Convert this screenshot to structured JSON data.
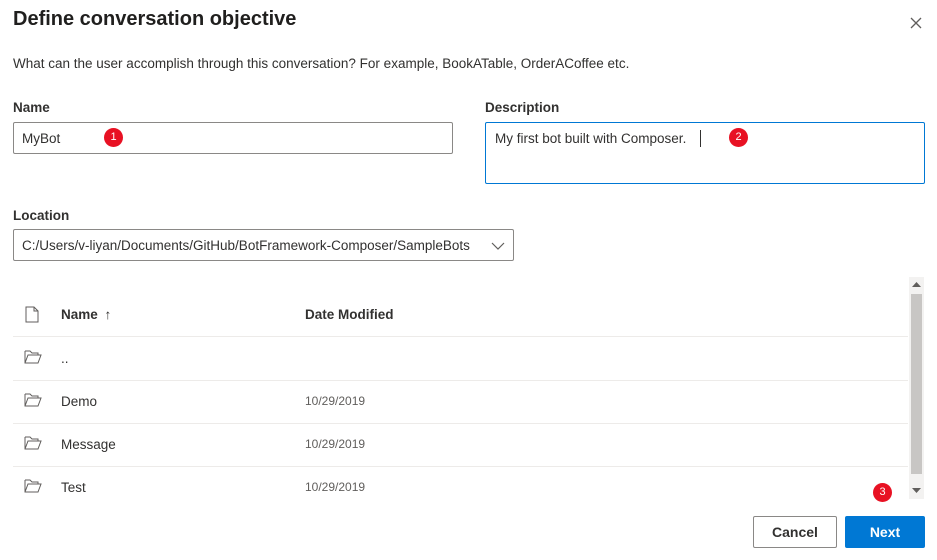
{
  "dialog": {
    "title": "Define conversation objective",
    "subtitle": "What can the user accomplish through this conversation? For example, BookATable, OrderACoffee etc."
  },
  "form": {
    "name_label": "Name",
    "name_value": "MyBot",
    "description_label": "Description",
    "description_value": "My first bot built with Composer.",
    "location_label": "Location",
    "location_value": "C:/Users/v-liyan/Documents/GitHub/BotFramework-Composer/SampleBots"
  },
  "badges": [
    "1",
    "2",
    "3"
  ],
  "file_list": {
    "header_name": "Name",
    "sort_indicator": "↑",
    "header_date": "Date Modified",
    "rows": [
      {
        "name": "..",
        "date": ""
      },
      {
        "name": "Demo",
        "date": "10/29/2019"
      },
      {
        "name": "Message",
        "date": "10/29/2019"
      },
      {
        "name": "Test",
        "date": "10/29/2019"
      }
    ]
  },
  "buttons": {
    "cancel": "Cancel",
    "next": "Next"
  },
  "icons": {
    "close": "close-icon",
    "file": "file-icon",
    "folder": "folder-open-icon",
    "chevron": "chevron-down-icon"
  },
  "colors": {
    "primary": "#0078d4",
    "badge": "#e81123",
    "border": "#8a8886"
  }
}
